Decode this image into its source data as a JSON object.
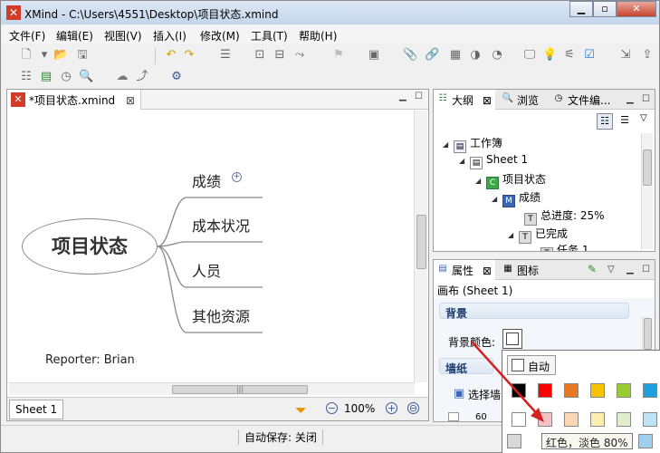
{
  "window": {
    "title": "XMind - C:\\Users\\4551\\Desktop\\项目状态.xmind"
  },
  "menu": [
    "文件(F)",
    "编辑(E)",
    "视图(V)",
    "插入(I)",
    "修改(M)",
    "工具(T)",
    "帮助(H)"
  ],
  "editor": {
    "tab_label": "*项目状态.xmind",
    "sheet_tab": "Sheet 1",
    "zoom": "100%",
    "mindmap": {
      "central": "项目状态",
      "branches": [
        "成绩",
        "成本状况",
        "人员",
        "其他资源"
      ],
      "reporter": "Reporter: Brian"
    }
  },
  "outline_panel": {
    "tabs": [
      "大纲",
      "浏览",
      "文件编..."
    ],
    "tree": [
      {
        "label": "工作簿",
        "icon": "workbook-icon"
      },
      {
        "label": "Sheet 1",
        "icon": "sheet-icon"
      },
      {
        "label": "项目状态",
        "icon": "central-topic-icon",
        "badge": "C"
      },
      {
        "label": "成绩",
        "icon": "main-topic-icon",
        "badge": "M"
      },
      {
        "label": "总进度: 25%",
        "icon": "topic-icon",
        "badge": "T"
      },
      {
        "label": "已完成",
        "icon": "topic-icon",
        "badge": "T"
      },
      {
        "label": "任务 1",
        "icon": "topic-icon",
        "badge": "T"
      }
    ]
  },
  "properties_panel": {
    "tabs": [
      "属性",
      "图标"
    ],
    "subtitle": "画布 (Sheet 1)",
    "background_section": "背景",
    "bg_color_label": "背景颜色:",
    "wallpaper_section": "墙纸",
    "choose_wallpaper": "选择墙",
    "partial_value": "60"
  },
  "color_popup": {
    "auto_label": "自动",
    "row1": [
      "#000000",
      "#ff0000",
      "#e87722",
      "#f7c300",
      "#9acd32",
      "#1ea0e0"
    ],
    "row2": [
      "#ffffff",
      "#f4c2c2",
      "#fbd6b3",
      "#fbeeb0",
      "#e0eecd",
      "#bfe3f6"
    ],
    "tooltip": "红色，淡色 80%"
  },
  "status": {
    "autosave": "自动保存: 关闭"
  }
}
